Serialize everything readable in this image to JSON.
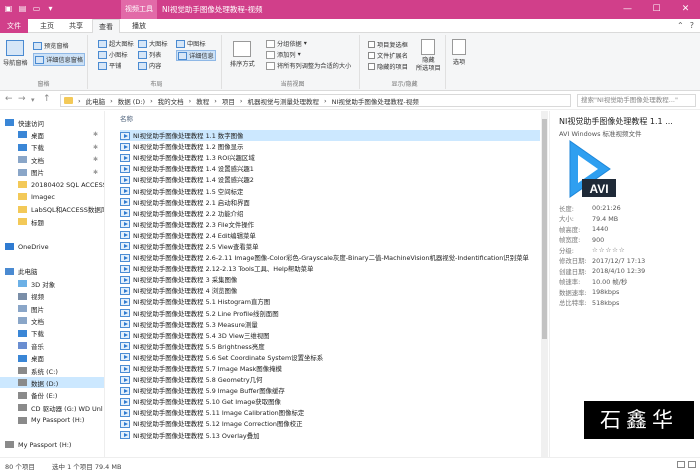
{
  "window": {
    "title": "NI视觉助手图像处理教程-视频",
    "context_tab": "视频工具",
    "quick_icons": [
      "▣",
      "▤",
      "▭",
      "▾"
    ],
    "controls": {
      "minimize": "—",
      "maximize": "☐",
      "close": "✕"
    }
  },
  "tabs": [
    "文件",
    "主页",
    "共享",
    "查看",
    "播放"
  ],
  "ribbon": {
    "panes": {
      "nav_pane": "导航窗格",
      "preview": "预览窗格",
      "details": "详细信息窗格",
      "group": "窗格"
    },
    "layout": {
      "items": [
        "超大图标",
        "大图标",
        "中图标",
        "小图标",
        "列表",
        "详细信息",
        "平铺",
        "内容"
      ],
      "group": "布局"
    },
    "current_view": {
      "sort": "排序方式",
      "group_by": "分组依据",
      "add_columns": "添加列",
      "fit_columns": "将所有列调整为合适的大小",
      "group": "当前视图"
    },
    "show_hide": {
      "checkboxes": "项目复选框",
      "extensions": "文件扩展名",
      "hidden": "隐藏的项目",
      "hide_selected": "隐藏\n所选项目",
      "group": "显示/隐藏"
    },
    "options": "选项"
  },
  "address": {
    "back": "←",
    "forward": "→",
    "up": "↑",
    "path": [
      "此电脑",
      "数据 (D:)",
      "我的文档",
      "教程",
      "项目",
      "机器视觉与测量处理教程",
      "NI视觉助手图像处理教程-视频"
    ],
    "search_placeholder": "搜索\"NI视觉助手图像处理教程...\""
  },
  "nav": [
    {
      "label": "快速访问",
      "icon": "star",
      "indent": 0
    },
    {
      "label": "桌面",
      "icon": "desktop",
      "indent": 1,
      "pin": true
    },
    {
      "label": "下载",
      "icon": "download",
      "indent": 1,
      "pin": true
    },
    {
      "label": "文档",
      "icon": "doc",
      "indent": 1,
      "pin": true
    },
    {
      "label": "图片",
      "icon": "pic",
      "indent": 1,
      "pin": true
    },
    {
      "label": "20180402 SQL ACCESS",
      "icon": "folder",
      "indent": 1
    },
    {
      "label": "Imagec",
      "icon": "folder",
      "indent": 1
    },
    {
      "label": "LabSQL和ACCESS数据库",
      "icon": "folder",
      "indent": 1
    },
    {
      "label": "标题",
      "icon": "folder",
      "indent": 1
    },
    {
      "label": "",
      "icon": "",
      "indent": 0
    },
    {
      "label": "OneDrive",
      "icon": "cloud",
      "indent": 0
    },
    {
      "label": "",
      "icon": "",
      "indent": 0
    },
    {
      "label": "此电脑",
      "icon": "pc",
      "indent": 0
    },
    {
      "label": "3D 对象",
      "icon": "obj3d",
      "indent": 1
    },
    {
      "label": "视频",
      "icon": "video",
      "indent": 1
    },
    {
      "label": "图片",
      "icon": "pic",
      "indent": 1
    },
    {
      "label": "文档",
      "icon": "doc",
      "indent": 1
    },
    {
      "label": "下载",
      "icon": "download",
      "indent": 1
    },
    {
      "label": "音乐",
      "icon": "music",
      "indent": 1
    },
    {
      "label": "桌面",
      "icon": "desktop",
      "indent": 1
    },
    {
      "label": "系统 (C:)",
      "icon": "drive",
      "indent": 1
    },
    {
      "label": "数据 (D:)",
      "icon": "drive",
      "indent": 1,
      "selected": true
    },
    {
      "label": "备份 (E:)",
      "icon": "drive",
      "indent": 1
    },
    {
      "label": "CD 驱动器 (G:) WD Unl",
      "icon": "cd",
      "indent": 1
    },
    {
      "label": "My Passport (H:)",
      "icon": "drive",
      "indent": 1
    },
    {
      "label": "",
      "icon": "",
      "indent": 0
    },
    {
      "label": "My Passport (H:)",
      "icon": "drive",
      "indent": 0
    }
  ],
  "list": {
    "column": "名称",
    "files": [
      "NI视觉助手图像处理教程 1.1 数字图像",
      "NI视觉助手图像处理教程 1.2   图像显示",
      "NI视觉助手图像处理教程 1.3 ROI兴趣区域",
      "NI视觉助手图像处理教程 1.4 设置感兴趣1",
      "NI视觉助手图像处理教程 1.4 设置感兴趣2",
      "NI视觉助手图像处理教程 1.5 空间标定",
      "NI视觉助手图像处理教程 2.1 启动和界面",
      "NI视觉助手图像处理教程 2.2 功能介绍",
      "NI视觉助手图像处理教程 2.3 File文件操作",
      "NI视觉助手图像处理教程 2.4 Edit编辑菜单",
      "NI视觉助手图像处理教程 2.5 View查看菜单",
      "NI视觉助手图像处理教程 2.6-2.11 Image图像-Color彩色-Grayscale灰度-Binary二值-MachineVision机器视觉-Indentification识别菜单",
      "NI视觉助手图像处理教程 2.12-2.13 Tools工具、Help帮助菜单",
      "NI视觉助手图像处理教程 3 采集图像",
      "NI视觉助手图像处理教程 4 浏览图像",
      "NI视觉助手图像处理教程 5.1 Histogram直方图",
      "NI视觉助手图像处理教程 5.2 Line Profile线剖面图",
      "NI视觉助手图像处理教程 5.3 Measure测量",
      "NI视觉助手图像处理教程 5.4 3D View三维视图",
      "NI视觉助手图像处理教程 5.5 Brightness亮度",
      "NI视觉助手图像处理教程 5.6 Set Coordinate System设置坐标系",
      "NI视觉助手图像处理教程 5.7 Image Mask图像掩模",
      "NI视觉助手图像处理教程 5.8 Geometry几何",
      "NI视觉助手图像处理教程 5.9 Image Buffer图像缓存",
      "NI视觉助手图像处理教程 5.10 Get Image获取图像",
      "NI视觉助手图像处理教程 5.11 Image Calibration图像标定",
      "NI视觉助手图像处理教程 5.12 Image Correction图像校正",
      "NI视觉助手图像处理教程 5.13 Overlay叠加"
    ]
  },
  "details": {
    "title": "NI视觉助手图像处理教程 1.1 ...",
    "type": "AVI  Windows 标准视频文件",
    "badge": "AVI",
    "props": [
      {
        "k": "长度:",
        "v": "00:21:26"
      },
      {
        "k": "大小:",
        "v": "79.4 MB"
      },
      {
        "k": "帧高度:",
        "v": "1440"
      },
      {
        "k": "帧宽度:",
        "v": "900"
      },
      {
        "k": "分级:",
        "v": "☆☆☆☆☆"
      },
      {
        "k": "修改日期:",
        "v": "2017/12/7 17:13"
      },
      {
        "k": "创建日期:",
        "v": "2018/4/10 12:39"
      },
      {
        "k": "帧速率:",
        "v": "10.00 帧/秒"
      },
      {
        "k": "数据速率:",
        "v": "198kbps"
      },
      {
        "k": "总比特率:",
        "v": "518kbps"
      }
    ],
    "watermark": "石鑫华"
  },
  "status": {
    "count": "80 个项目",
    "selected": "选中 1 个项目  79.4 MB"
  }
}
